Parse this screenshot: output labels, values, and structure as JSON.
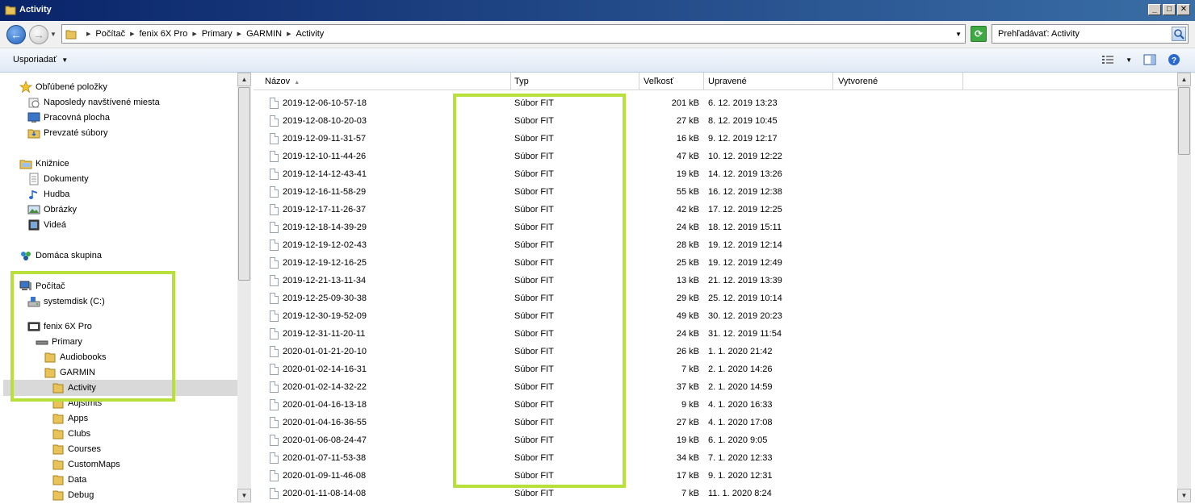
{
  "window": {
    "title": "Activity",
    "controls": [
      "_",
      "□",
      "✕"
    ]
  },
  "address": {
    "crumbs": [
      "Počítač",
      "fenix 6X Pro",
      "Primary",
      "GARMIN",
      "Activity"
    ],
    "search_placeholder": "Prehľadávať: Activity"
  },
  "toolbar": {
    "organize_label": "Usporiadať"
  },
  "nav": {
    "favorites": {
      "header": "Obľúbené položky",
      "items": [
        "Naposledy navštívené miesta",
        "Pracovná plocha",
        "Prevzaté súbory"
      ]
    },
    "libraries": {
      "header": "Knižnice",
      "items": [
        "Dokumenty",
        "Hudba",
        "Obrázky",
        "Videá"
      ]
    },
    "homegroup": "Domáca skupina",
    "computer": {
      "header": "Počítač",
      "drive": "systemdisk (C:)",
      "device": "fenix 6X Pro",
      "storage": "Primary",
      "folders_l1": [
        "Audiobooks",
        "GARMIN"
      ],
      "folders_l2": [
        "Activity",
        "Adjstmts",
        "Apps",
        "Clubs",
        "Courses",
        "CustomMaps",
        "Data",
        "Debug"
      ]
    }
  },
  "columns": {
    "name": "Názov",
    "type": "Typ",
    "size": "Veľkosť",
    "modified": "Upravené",
    "created": "Vytvorené"
  },
  "files": [
    {
      "name": "2019-12-06-10-57-18",
      "type": "Súbor FIT",
      "size": "201 kB",
      "modified": "6. 12. 2019 13:23"
    },
    {
      "name": "2019-12-08-10-20-03",
      "type": "Súbor FIT",
      "size": "27 kB",
      "modified": "8. 12. 2019 10:45"
    },
    {
      "name": "2019-12-09-11-31-57",
      "type": "Súbor FIT",
      "size": "16 kB",
      "modified": "9. 12. 2019 12:17"
    },
    {
      "name": "2019-12-10-11-44-26",
      "type": "Súbor FIT",
      "size": "47 kB",
      "modified": "10. 12. 2019 12:22"
    },
    {
      "name": "2019-12-14-12-43-41",
      "type": "Súbor FIT",
      "size": "19 kB",
      "modified": "14. 12. 2019 13:26"
    },
    {
      "name": "2019-12-16-11-58-29",
      "type": "Súbor FIT",
      "size": "55 kB",
      "modified": "16. 12. 2019 12:38"
    },
    {
      "name": "2019-12-17-11-26-37",
      "type": "Súbor FIT",
      "size": "42 kB",
      "modified": "17. 12. 2019 12:25"
    },
    {
      "name": "2019-12-18-14-39-29",
      "type": "Súbor FIT",
      "size": "24 kB",
      "modified": "18. 12. 2019 15:11"
    },
    {
      "name": "2019-12-19-12-02-43",
      "type": "Súbor FIT",
      "size": "28 kB",
      "modified": "19. 12. 2019 12:14"
    },
    {
      "name": "2019-12-19-12-16-25",
      "type": "Súbor FIT",
      "size": "25 kB",
      "modified": "19. 12. 2019 12:49"
    },
    {
      "name": "2019-12-21-13-11-34",
      "type": "Súbor FIT",
      "size": "13 kB",
      "modified": "21. 12. 2019 13:39"
    },
    {
      "name": "2019-12-25-09-30-38",
      "type": "Súbor FIT",
      "size": "29 kB",
      "modified": "25. 12. 2019 10:14"
    },
    {
      "name": "2019-12-30-19-52-09",
      "type": "Súbor FIT",
      "size": "49 kB",
      "modified": "30. 12. 2019 20:23"
    },
    {
      "name": "2019-12-31-11-20-11",
      "type": "Súbor FIT",
      "size": "24 kB",
      "modified": "31. 12. 2019 11:54"
    },
    {
      "name": "2020-01-01-21-20-10",
      "type": "Súbor FIT",
      "size": "26 kB",
      "modified": "1. 1. 2020 21:42"
    },
    {
      "name": "2020-01-02-14-16-31",
      "type": "Súbor FIT",
      "size": "7 kB",
      "modified": "2. 1. 2020 14:26"
    },
    {
      "name": "2020-01-02-14-32-22",
      "type": "Súbor FIT",
      "size": "37 kB",
      "modified": "2. 1. 2020 14:59"
    },
    {
      "name": "2020-01-04-16-13-18",
      "type": "Súbor FIT",
      "size": "9 kB",
      "modified": "4. 1. 2020 16:33"
    },
    {
      "name": "2020-01-04-16-36-55",
      "type": "Súbor FIT",
      "size": "27 kB",
      "modified": "4. 1. 2020 17:08"
    },
    {
      "name": "2020-01-06-08-24-47",
      "type": "Súbor FIT",
      "size": "19 kB",
      "modified": "6. 1. 2020 9:05"
    },
    {
      "name": "2020-01-07-11-53-38",
      "type": "Súbor FIT",
      "size": "34 kB",
      "modified": "7. 1. 2020 12:33"
    },
    {
      "name": "2020-01-09-11-46-08",
      "type": "Súbor FIT",
      "size": "17 kB",
      "modified": "9. 1. 2020 12:31"
    },
    {
      "name": "2020-01-11-08-14-08",
      "type": "Súbor FIT",
      "size": "7 kB",
      "modified": "11. 1. 2020 8:24"
    }
  ],
  "colors": {
    "highlight": "#b7e03b",
    "titlebar": "#0a246a"
  },
  "icons": {
    "back": "back-arrow-icon",
    "forward": "forward-arrow-icon",
    "refresh": "refresh-icon",
    "search": "search-icon",
    "views": "view-options-icon",
    "preview": "preview-pane-icon",
    "help": "help-icon"
  }
}
